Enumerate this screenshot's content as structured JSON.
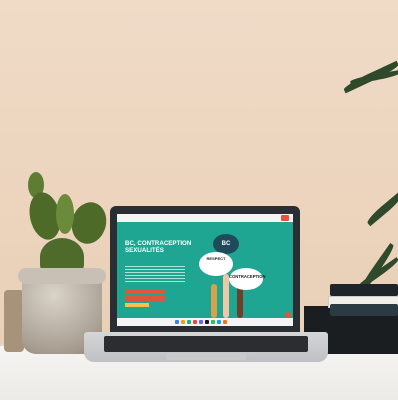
{
  "scene": {
    "colors": {
      "wall": "#ecd4bd",
      "table": "#f4f2ee",
      "cactus": "#4e6a29",
      "laptop_body": "#2a2d31",
      "screen_bg": "#1fa693",
      "accent": "#e2543c"
    }
  },
  "laptop_screen": {
    "headline": "BC, CONTRACEPTION SEXUALITÉS",
    "bubble_top": "BC",
    "bubble_left": "RESPECT",
    "bubble_right": "CONTRACEPTION"
  }
}
